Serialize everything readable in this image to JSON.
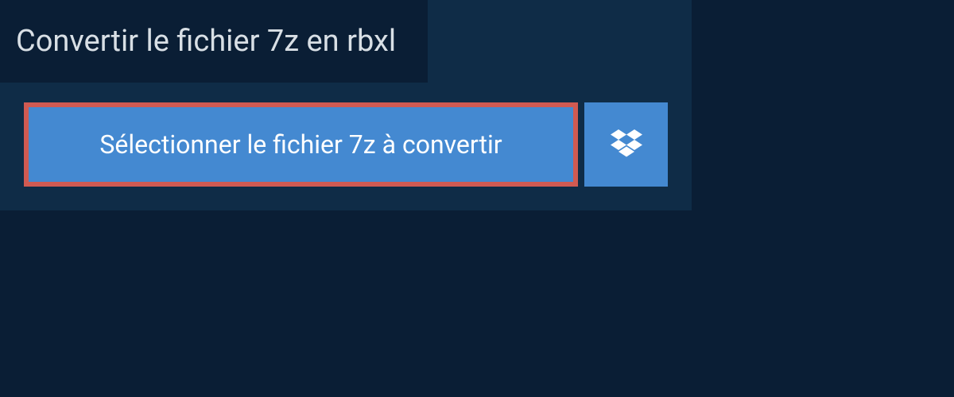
{
  "header": {
    "title": "Convertir le fichier 7z en rbxl"
  },
  "actions": {
    "select_file_label": "Sélectionner le fichier 7z à convertir"
  },
  "colors": {
    "page_bg": "#0a1e35",
    "panel_bg": "#0f2c47",
    "button_bg": "#4489d1",
    "highlight_border": "#d05a52",
    "text_light": "#d8dfe5",
    "text_white": "#ffffff"
  }
}
